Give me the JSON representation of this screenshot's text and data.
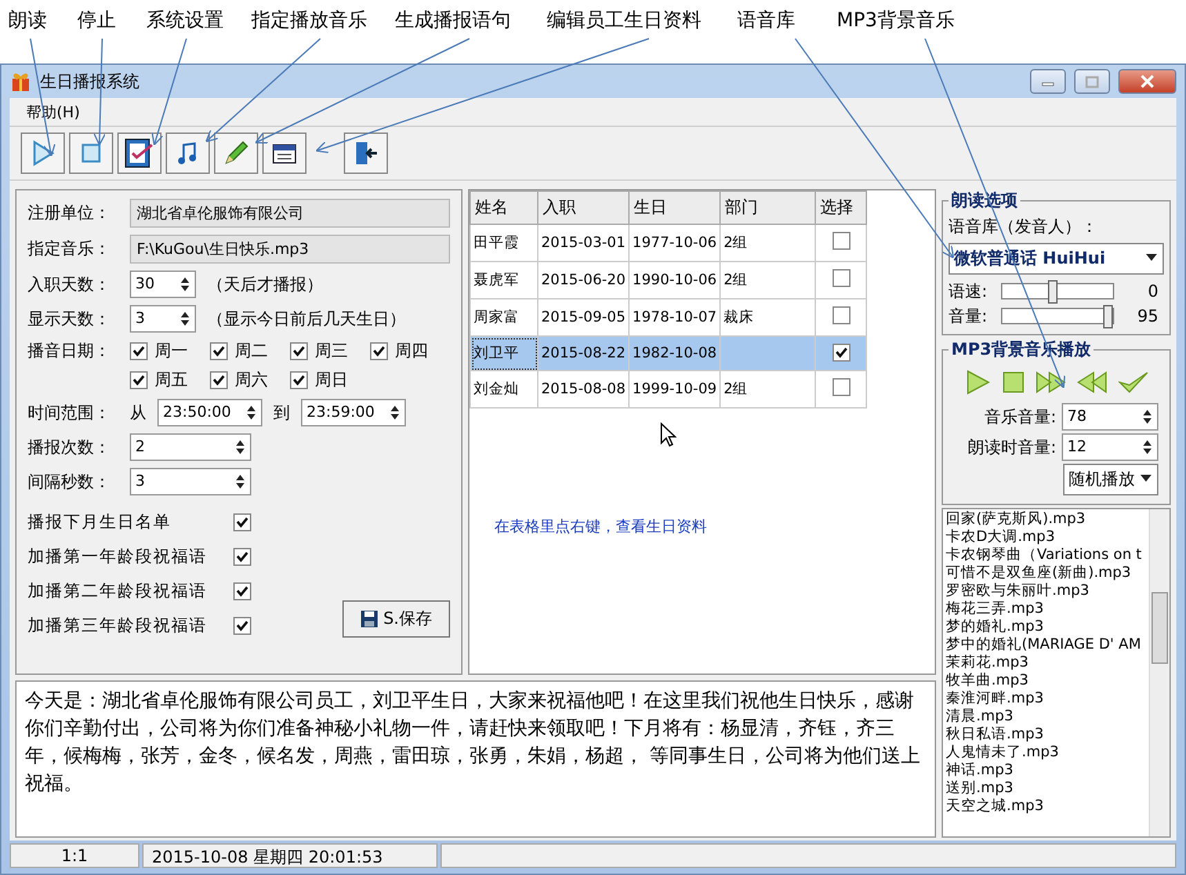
{
  "annotations": [
    {
      "label": "朗读"
    },
    {
      "label": "停止"
    },
    {
      "label": "系统设置"
    },
    {
      "label": "指定播放音乐"
    },
    {
      "label": "生成播报语句"
    },
    {
      "label": "编辑员工生日资料"
    },
    {
      "label": "语音库"
    },
    {
      "label": "MP3背景音乐"
    }
  ],
  "window": {
    "title": "生日播报系统"
  },
  "menu": [
    "帮助(H)"
  ],
  "form": {
    "company": {
      "label": "注册单位：",
      "value": "湖北省卓伦服饰有限公司"
    },
    "music": {
      "label": "指定音乐：",
      "value": "F:\\KuGou\\生日快乐.mp3"
    },
    "join_days": {
      "label": "入职天数：",
      "value": "30",
      "note": "（天后才播报）"
    },
    "show_days": {
      "label": "显示天数：",
      "value": "3",
      "note": "（显示今日前后几天生日）"
    },
    "weekdays": {
      "label": "播音日期：",
      "days": [
        {
          "label": "周一",
          "checked": true
        },
        {
          "label": "周二",
          "checked": true
        },
        {
          "label": "周三",
          "checked": true
        },
        {
          "label": "周四",
          "checked": true
        },
        {
          "label": "周五",
          "checked": true
        },
        {
          "label": "周六",
          "checked": true
        },
        {
          "label": "周日",
          "checked": true
        }
      ]
    },
    "time_range": {
      "label": "时间范围：",
      "from_label": "从",
      "from": "23:50:00",
      "to_label": "到",
      "to": "23:59:00"
    },
    "times": {
      "label": "播报次数：",
      "value": "2"
    },
    "interval": {
      "label": "间隔秒数：",
      "value": "3"
    },
    "options": [
      {
        "label": "播报下月生日名单",
        "checked": true
      },
      {
        "label": "加播第一年龄段祝福语",
        "checked": true
      },
      {
        "label": "加播第二年龄段祝福语",
        "checked": true
      },
      {
        "label": "加播第三年龄段祝福语",
        "checked": true
      }
    ],
    "save_button": "S.保存"
  },
  "table": {
    "columns": [
      "姓名",
      "入职",
      "生日",
      "部门",
      "选择"
    ],
    "rows": [
      {
        "cells": [
          "田平霞",
          "2015-03-01",
          "1977-10-06",
          "2组"
        ],
        "checked": false,
        "selected": false
      },
      {
        "cells": [
          "聂虎军",
          "2015-06-20",
          "1990-10-06",
          "2组"
        ],
        "checked": false,
        "selected": false
      },
      {
        "cells": [
          "周家富",
          "2015-09-05",
          "1978-10-07",
          "裁床"
        ],
        "checked": false,
        "selected": false
      },
      {
        "cells": [
          "刘卫平",
          "2015-08-22",
          "1982-10-08",
          ""
        ],
        "checked": true,
        "selected": true
      },
      {
        "cells": [
          "刘金灿",
          "2015-08-08",
          "1999-10-09",
          "2组"
        ],
        "checked": false,
        "selected": false
      }
    ],
    "hint": "在表格里点右键，查看生日资料"
  },
  "reading_options": {
    "title": "朗读选项",
    "voice_label": "语音库（发音人）：",
    "voice": "微软普通话 HuiHui",
    "sliders": [
      {
        "label": "语速:",
        "level": 0.45,
        "reading": "0"
      },
      {
        "label": "音量:",
        "level": 0.95,
        "reading": "95"
      }
    ]
  },
  "mp3": {
    "title": "MP3背景音乐播放",
    "music_volume": {
      "label": "音乐音量:",
      "value": "78"
    },
    "read_volume": {
      "label": "朗读时音量:",
      "value": "12"
    },
    "mode": "随机播放"
  },
  "playlist": [
    "回家(萨克斯风).mp3",
    "卡农D大调.mp3",
    "卡农钢琴曲（Variations on t",
    "可惜不是双鱼座(新曲).mp3",
    "罗密欧与朱丽叶.mp3",
    "梅花三弄.mp3",
    "梦的婚礼.mp3",
    "梦中的婚礼(MARIAGE D' AM",
    "茉莉花.mp3",
    "牧羊曲.mp3",
    "秦淮河畔.mp3",
    "清晨.mp3",
    "秋日私语.mp3",
    "人鬼情未了.mp3",
    "神话.mp3",
    "送别.mp3",
    "天空之城.mp3"
  ],
  "message": "今天是：湖北省卓伦服饰有限公司员工，刘卫平生日，大家来祝福他吧！在这里我们祝他生日快乐，感谢你们辛勤付出，公司将为你们准备神秘小礼物一件，请赶快来领取吧！下月将有：杨显清，齐钰，齐三年，候梅梅，张芳，金冬，候名发，周燕，雷田琼，张勇，朱娟，杨超， 等同事生日，公司将为他们送上祝福。",
  "status_bar": [
    "1:1",
    "2015-10-08 星期四 20:01:53"
  ]
}
